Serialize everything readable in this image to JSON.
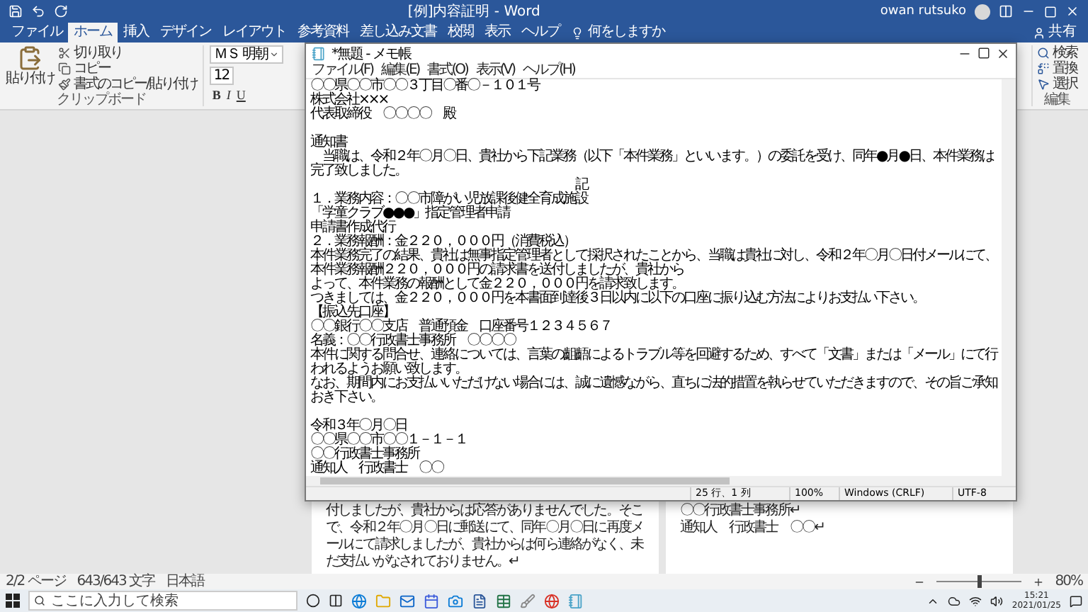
{
  "word": {
    "title": "[例]内容証明 - Word",
    "user": "owan rutsuko",
    "share": "共有",
    "tabs": [
      {
        "label": "ファイル",
        "selected": false
      },
      {
        "label": "ホーム",
        "selected": true
      },
      {
        "label": "挿入",
        "selected": false
      },
      {
        "label": "デザイン",
        "selected": false
      },
      {
        "label": "レイアウト",
        "selected": false
      },
      {
        "label": "参考資料",
        "selected": false
      },
      {
        "label": "差し込み文書",
        "selected": false
      },
      {
        "label": "校閲",
        "selected": false
      },
      {
        "label": "表示",
        "selected": false
      },
      {
        "label": "ヘルプ",
        "selected": false
      }
    ],
    "tell_me": "何をしますか",
    "clipboard": {
      "paste": "貼り付け",
      "items": [
        {
          "kind": "cut",
          "label": "切り取り"
        },
        {
          "kind": "copy",
          "label": "コピー"
        },
        {
          "kind": "format",
          "label": "書式のコピー/貼り付け"
        }
      ],
      "group": "クリップボード"
    },
    "font": {
      "name": "ＭＳ 明朝",
      "size": "12",
      "styles": [
        "B",
        "I",
        "U"
      ]
    },
    "editing": {
      "items": [
        {
          "kind": "find",
          "label": "検索"
        },
        {
          "kind": "replace",
          "label": "置換"
        },
        {
          "kind": "select",
          "label": "選択"
        }
      ],
      "group": "編集"
    },
    "pages": [
      {
        "lines": [
          "付しましたが、貴社からは応答がありませんでした。そこ",
          "で、令和２年〇月〇日に郵送にて、同年〇月〇日に再度メ",
          "ールにて請求しましたが、貴社からは何ら連絡がなく、未",
          "だ支払いがなされておりません。↵"
        ]
      },
      {
        "lines": [
          "〇〇行政書士事務所↵",
          "通知人　行政書士　〇〇↵"
        ]
      }
    ],
    "status": {
      "page": "2/2 ページ",
      "words": "643/643 文字",
      "language": "日本語",
      "zoom": "80%",
      "level": 0.5
    }
  },
  "notepad": {
    "title": "*無題 - メモ帳",
    "menu": [
      "ファイル(F)",
      "編集(E)",
      "書式(O)",
      "表示(V)",
      "ヘルプ(H)"
    ],
    "blocks": [
      [
        "〇〇県〇〇市〇〇３丁目〇番〇－１０１号",
        "株式会社×××",
        "代表取締役　〇〇〇〇　殿"
      ],
      [
        "通知書",
        "　当職は、令和２年〇月〇日、貴社から下記業務（以下「本件業務」といいます。）の委託を受け、同年●月●日、本件業務は完了致しました。",
        "　　　　　　　　　　　　　　　　　　　　　　記",
        "１．業務内容：〇〇市障がい児放課後健全育成施設",
        "「学童クラブ●●●」指定管理者申請",
        "申請書作成代行",
        "２．業務報酬：金２２０，０００円（消費税込）",
        "本件業務完了の結果、貴社は無事指定管理者として採択されたことから、当職は貴社に対し、令和２年〇月〇日付メールにて、本件業務報酬２２０，０００円の請求書を送付しましたが、貴社から",
        "よって、本件業務の報酬として金２２０，０００円を請求致します。",
        "つきましては、金２２０，０００円を本書面到達後３日以内に以下の口座に振り込む方法によりお支払い下さい。",
        "【振込先口座】",
        "〇〇銀行〇〇支店　普通預金　口座番号１２３４５６７",
        "名義：〇〇行政書士事務所　〇〇〇〇",
        "本件に関する問合せ、連絡については、言葉の齟齬によるトラブル等を回避するため、すべて「文書」または「メール」にて行われるようお願い致します。",
        "なお、期間内にお支払いいただけない場合には、誠に遺憾ながら、直ちに法的措置を執らせていただきますので、その旨ご承知おき下さい。"
      ],
      [
        "令和３年〇月〇日",
        "〇〇県〇〇市〇〇１－１－１",
        "〇〇行政書士事務所",
        "通知人　行政書士　〇〇"
      ]
    ],
    "status": [
      "25 行、1 列",
      "100%",
      "Windows (CRLF)",
      "UTF-8"
    ]
  },
  "taskbar": {
    "placeholder": "ここに入力して検索",
    "time": "15:21",
    "date": "2021/01/25"
  }
}
